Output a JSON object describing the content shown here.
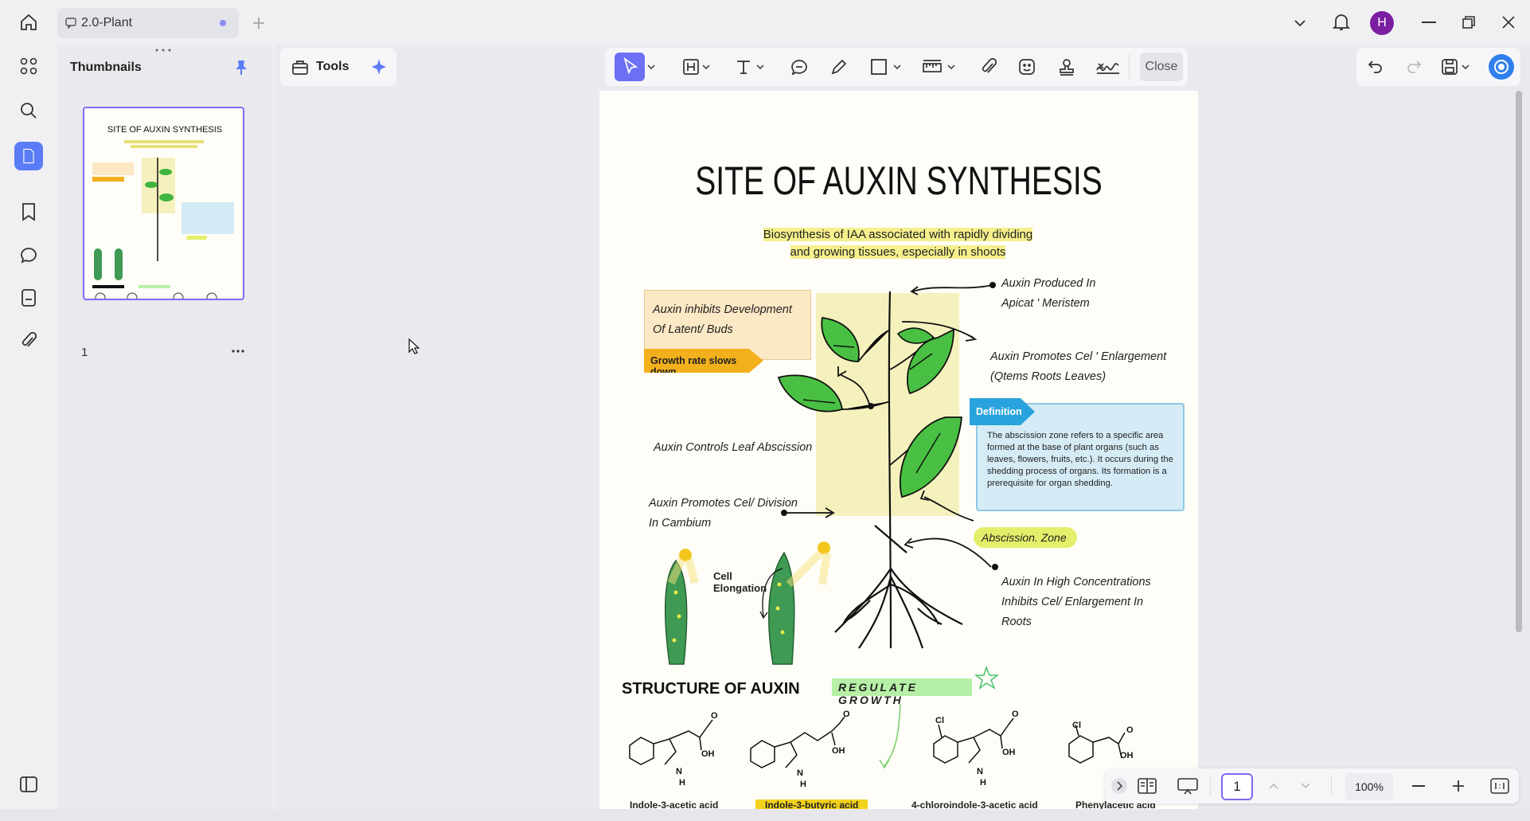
{
  "tab": {
    "title": "2.0-Plant"
  },
  "user": {
    "initial": "H",
    "avatar_color": "#7b1fa2"
  },
  "panel": {
    "title": "Thumbnails",
    "page_number": "1"
  },
  "tools": {
    "label": "Tools"
  },
  "toolbar": {
    "close_label": "Close"
  },
  "document": {
    "title": "SITE OF AUXIN SYNTHESIS",
    "subtitle_line1": "Biosynthesis of IAA associated with rapidly dividing",
    "subtitle_line2": "and growing tissues, especially in shoots",
    "latent_line1": "Auxin inhibits Development",
    "latent_line2": "Of Latent/ Buds",
    "growth_tag": "Growth rate slows down",
    "produced_line1": "Auxin Produced In",
    "produced_line2": "Apicat ' Meristem",
    "promotes_line1": "Auxin Promotes Cel ' Enlargement",
    "promotes_line2": "(Qtems Roots Leaves)",
    "definition_tag": "Definition",
    "definition_text": "The abscission zone refers to a specific area formed at the base of plant organs (such as leaves, flowers, fruits, etc.). It occurs during the shedding process of organs. Its formation is a prerequisite for organ shedding.",
    "leaf_abscission": "Auxin Controls Leaf Abscission",
    "division_line1": "Auxin  Promotes  Cel/  Division",
    "division_line2": "In  Cambium",
    "zone_label": "Abscission. Zone",
    "cell_elong_line1": "Cell",
    "cell_elong_line2": "Elongation",
    "high_line1": "Auxin In High Concentrations",
    "high_line2": "Inhibits Cel/ Enlargement In",
    "high_line3": "Roots",
    "structure_title": "STRUCTURE OF AUXIN",
    "regulate_label": "REGULATE GROWTH",
    "chem_names": [
      "Indole-3-acetic acid",
      "Indole-3-butyric acid",
      "4-chloroindole-3-acetic acid",
      "Phenylacetic acid"
    ],
    "atoms": {
      "oh": "OH",
      "o": "O",
      "n": "N",
      "h": "H",
      "cl": "Cl"
    }
  },
  "bottom": {
    "page": "1",
    "zoom": "100%"
  },
  "colors": {
    "accent": "#7b6cf2",
    "definition": "#29a3dd",
    "growth_tag": "#f2b01c",
    "zone": "#e3ef6a",
    "regulate": "#b6f0a6"
  }
}
